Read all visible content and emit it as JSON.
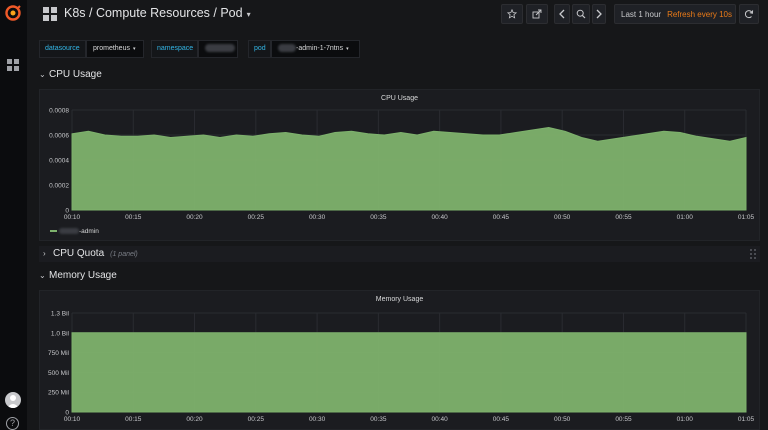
{
  "header": {
    "title": "K8s / Compute Resources / Pod",
    "title_caret": "▾",
    "time_range": "Last 1 hour",
    "refresh": "Refresh every 10s"
  },
  "variables": [
    {
      "label": "datasource",
      "value": "prometheus",
      "redacted": false
    },
    {
      "label": "namespace",
      "value": "",
      "redacted": true
    },
    {
      "label": "pod",
      "value": "-admin-1-7ntns",
      "redacted": true
    }
  ],
  "rows": {
    "cpu_usage": {
      "title": "CPU Usage"
    },
    "cpu_quota": {
      "title": "CPU Quota",
      "subtitle": "(1 panel)"
    },
    "memory_usage": {
      "title": "Memory Usage"
    }
  },
  "colors": {
    "series": "#7eb26d",
    "accent": "#eb7b18",
    "link": "#33b5e5"
  },
  "icons": {
    "logo": "grafana-logo-icon",
    "star": "star-icon",
    "share": "share-icon",
    "back": "chevron-left-icon",
    "zoom": "search-icon",
    "forward": "chevron-right-icon",
    "clock": "clock-icon",
    "refresh": "refresh-icon",
    "dashboards": "dashboards-icon",
    "help": "help-icon"
  },
  "help_glyph": "?",
  "chart_data": [
    {
      "type": "area",
      "title": "CPU Usage",
      "x": [
        "00:10",
        "00:15",
        "00:20",
        "00:25",
        "00:30",
        "00:35",
        "00:40",
        "00:45",
        "00:50",
        "00:55",
        "01:00",
        "01:05"
      ],
      "y_ticks": [
        "0",
        "0.0002",
        "0.0004",
        "0.0006",
        "0.0008"
      ],
      "ylim": [
        0,
        0.0008
      ],
      "series": [
        {
          "name": "-admin",
          "redacted_name": true,
          "values": [
            0.00061,
            0.00063,
            0.0006,
            0.00059,
            0.00059,
            0.0006,
            0.00058,
            0.00059,
            0.0006,
            0.00058,
            0.0006,
            0.00059,
            0.00061,
            0.00062,
            0.0006,
            0.00059,
            0.00062,
            0.00063,
            0.00061,
            0.0006,
            0.00062,
            0.0006,
            0.00063,
            0.00062,
            0.00061,
            0.0006,
            0.0006,
            0.00062,
            0.00064,
            0.00066,
            0.00063,
            0.00058,
            0.00055,
            0.00057,
            0.00059,
            0.00061,
            0.00063,
            0.00062,
            0.00059,
            0.00057,
            0.00055,
            0.00058
          ]
        }
      ],
      "legend": "bottom-left",
      "grid": true
    },
    {
      "type": "area",
      "title": "Memory Usage",
      "x": [
        "00:10",
        "00:15",
        "00:20",
        "00:25",
        "00:30",
        "00:35",
        "00:40",
        "00:45",
        "00:50",
        "00:55",
        "01:00",
        "01:05"
      ],
      "y_ticks": [
        "0",
        "250 Mil",
        "500 Mil",
        "750 Mil",
        "1.0 Bil",
        "1.3 Bil"
      ],
      "ylim": [
        0,
        1250000000
      ],
      "series": [
        {
          "values": [
            1000000000,
            1000000000,
            1000000000,
            1000000000,
            1000000000,
            1000000000,
            1000000000,
            1000000000,
            1000000000,
            1000000000,
            1000000000,
            1000000000
          ]
        }
      ],
      "grid": true
    }
  ]
}
